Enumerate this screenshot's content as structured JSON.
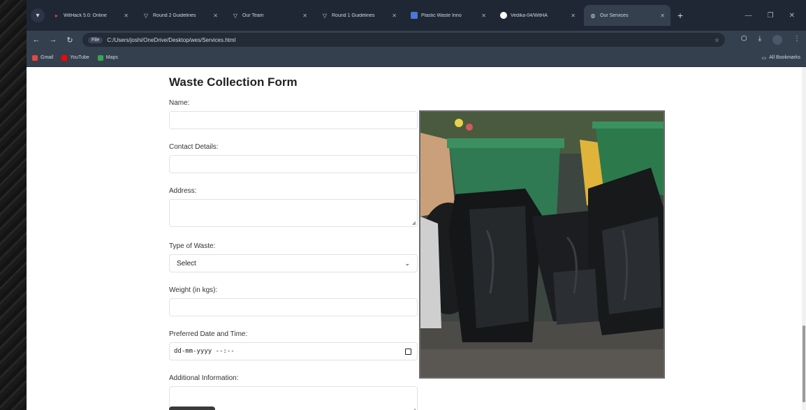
{
  "browser": {
    "tabs": [
      {
        "title": "WitHack 5.0: Online",
        "icon_color": "#e8473c",
        "active": false
      },
      {
        "title": "Round 2 Guidelines",
        "icon_color": "#c9d1dc",
        "active": false
      },
      {
        "title": "Our Team",
        "icon_color": "#c9d1dc",
        "active": false
      },
      {
        "title": "Round 1 Guidelines",
        "icon_color": "#c9d1dc",
        "active": false
      },
      {
        "title": "Plastic Waste Inno",
        "icon_color": "#4a78d6",
        "active": false
      },
      {
        "title": "Vedika-04/WitHA",
        "icon_color": "#ffffff",
        "active": false
      },
      {
        "title": "Our Services",
        "icon_color": "#c9d1dc",
        "active": true
      }
    ],
    "address": {
      "chip": "File",
      "url": "C:/Users/joshi/OneDrive/Desktop/wes/Services.html"
    },
    "bookmarks": [
      {
        "label": "Gmail",
        "color": "#e8473c"
      },
      {
        "label": "YouTube",
        "color": "#ff0000"
      },
      {
        "label": "Maps",
        "color": "#34a853"
      }
    ],
    "all_bookmarks": "All Bookmarks"
  },
  "form": {
    "title": "Waste Collection Form",
    "name_label": "Name:",
    "contact_label": "Contact Details:",
    "address_label": "Address:",
    "waste_type_label": "Type of Waste:",
    "waste_type_value": "Select",
    "weight_label": "Weight (in kgs):",
    "datetime_label": "Preferred Date and Time:",
    "datetime_placeholder": "dd-mm-yyyy --:--",
    "additional_label": "Additional Information:"
  }
}
